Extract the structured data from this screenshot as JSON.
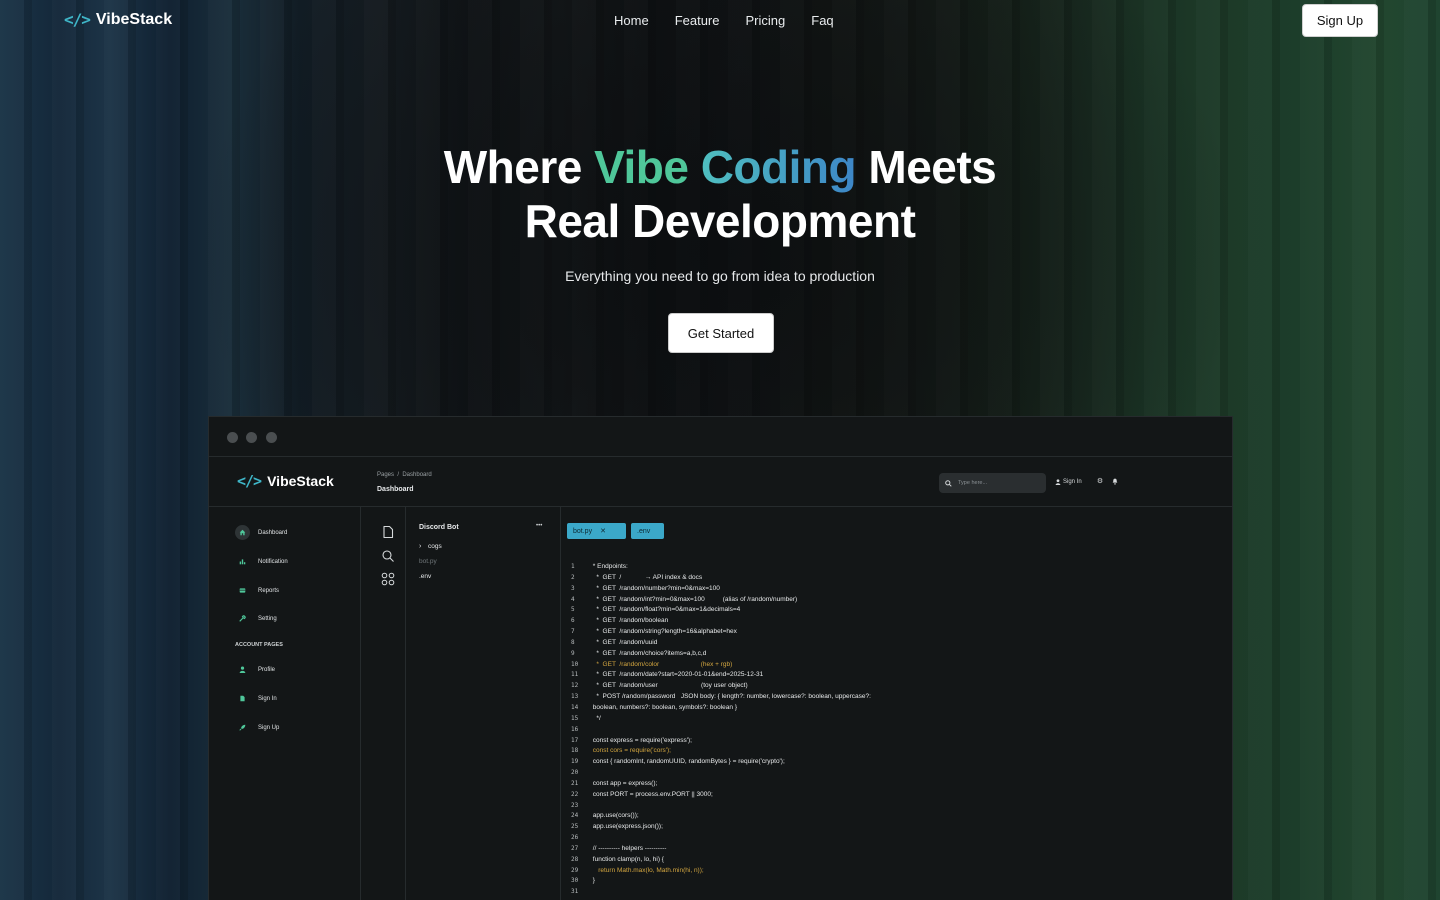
{
  "nav": {
    "brand_icon": "</>",
    "brand_name": "VibeStack",
    "links": [
      "Home",
      "Feature",
      "Pricing",
      "Faq"
    ],
    "signup_label": "Sign Up"
  },
  "hero": {
    "title_part1": "Where ",
    "title_vibe": "Vibe",
    "title_space": " ",
    "title_coding": "Coding",
    "title_part2": " Meets",
    "title_line2": "Real Development",
    "subtitle": "Everything you need to go from idea to production",
    "cta_label": "Get Started",
    "accent_green": "#4fc79a",
    "accent_blue": "#3d86c7"
  },
  "app": {
    "brand_icon": "</>",
    "brand_name": "VibeStack",
    "breadcrumb": "Pages  /  Dashboard",
    "page_title": "Dashboard",
    "search_placeholder": "Type here...",
    "signin_label": "Sign In",
    "sidebar": {
      "items": [
        {
          "label": "Dashboard",
          "icon": "home-icon"
        },
        {
          "label": "Notification",
          "icon": "bar-chart-icon"
        },
        {
          "label": "Reports",
          "icon": "card-icon"
        },
        {
          "label": "Setting",
          "icon": "wrench-icon"
        }
      ],
      "section_label": "ACCOUNT PAGES",
      "account_items": [
        {
          "label": "Profile",
          "icon": "person-icon"
        },
        {
          "label": "Sign In",
          "icon": "document-icon"
        },
        {
          "label": "Sign Up",
          "icon": "rocket-icon"
        }
      ]
    },
    "explorer": {
      "title": "Discord Bot",
      "more": "•••",
      "folder": "cogs",
      "file1": "bot.py",
      "file2": ".env"
    },
    "tabs": [
      {
        "label": "bot.py",
        "close": "✕"
      },
      {
        "label": ".env"
      }
    ],
    "code_lines": [
      " * Endpoints:",
      "   *  GET  /             → API index & docs",
      "   *  GET  /random/number?min=0&max=100",
      "   *  GET  /random/int?min=0&max=100          (alias of /random/number)",
      "   *  GET  /random/float?min=0&max=1&decimals=4",
      "   *  GET  /random/boolean",
      "   *  GET  /random/string?length=16&alphabet=hex",
      "   *  GET  /random/uuid",
      "   *  GET  /random/choice?items=a,b,c,d",
      "   *  GET  /random/color                       (hex + rgb)",
      "   *  GET  /random/date?start=2020-01-01&end=2025-12-31",
      "   *  GET  /random/user                        (toy user object)",
      "   *  POST /random/password   JSON body: { length?: number, lowercase?: boolean, uppercase?:",
      " boolean, numbers?: boolean, symbols?: boolean }",
      "   */",
      "",
      " const express = require('express');",
      " const cors = require('cors');",
      " const { randomInt, randomUUID, randomBytes } = require('crypto');",
      "",
      " const app = express();",
      " const PORT = process.env.PORT || 3000;",
      "",
      " app.use(cors());",
      " app.use(express.json());",
      "",
      " // ---------- helpers ----------",
      " function clamp(n, lo, hi) {",
      "    return Math.max(lo, Math.min(hi, n));",
      " }",
      ""
    ],
    "highlight_lines": [
      10,
      18,
      29
    ]
  }
}
